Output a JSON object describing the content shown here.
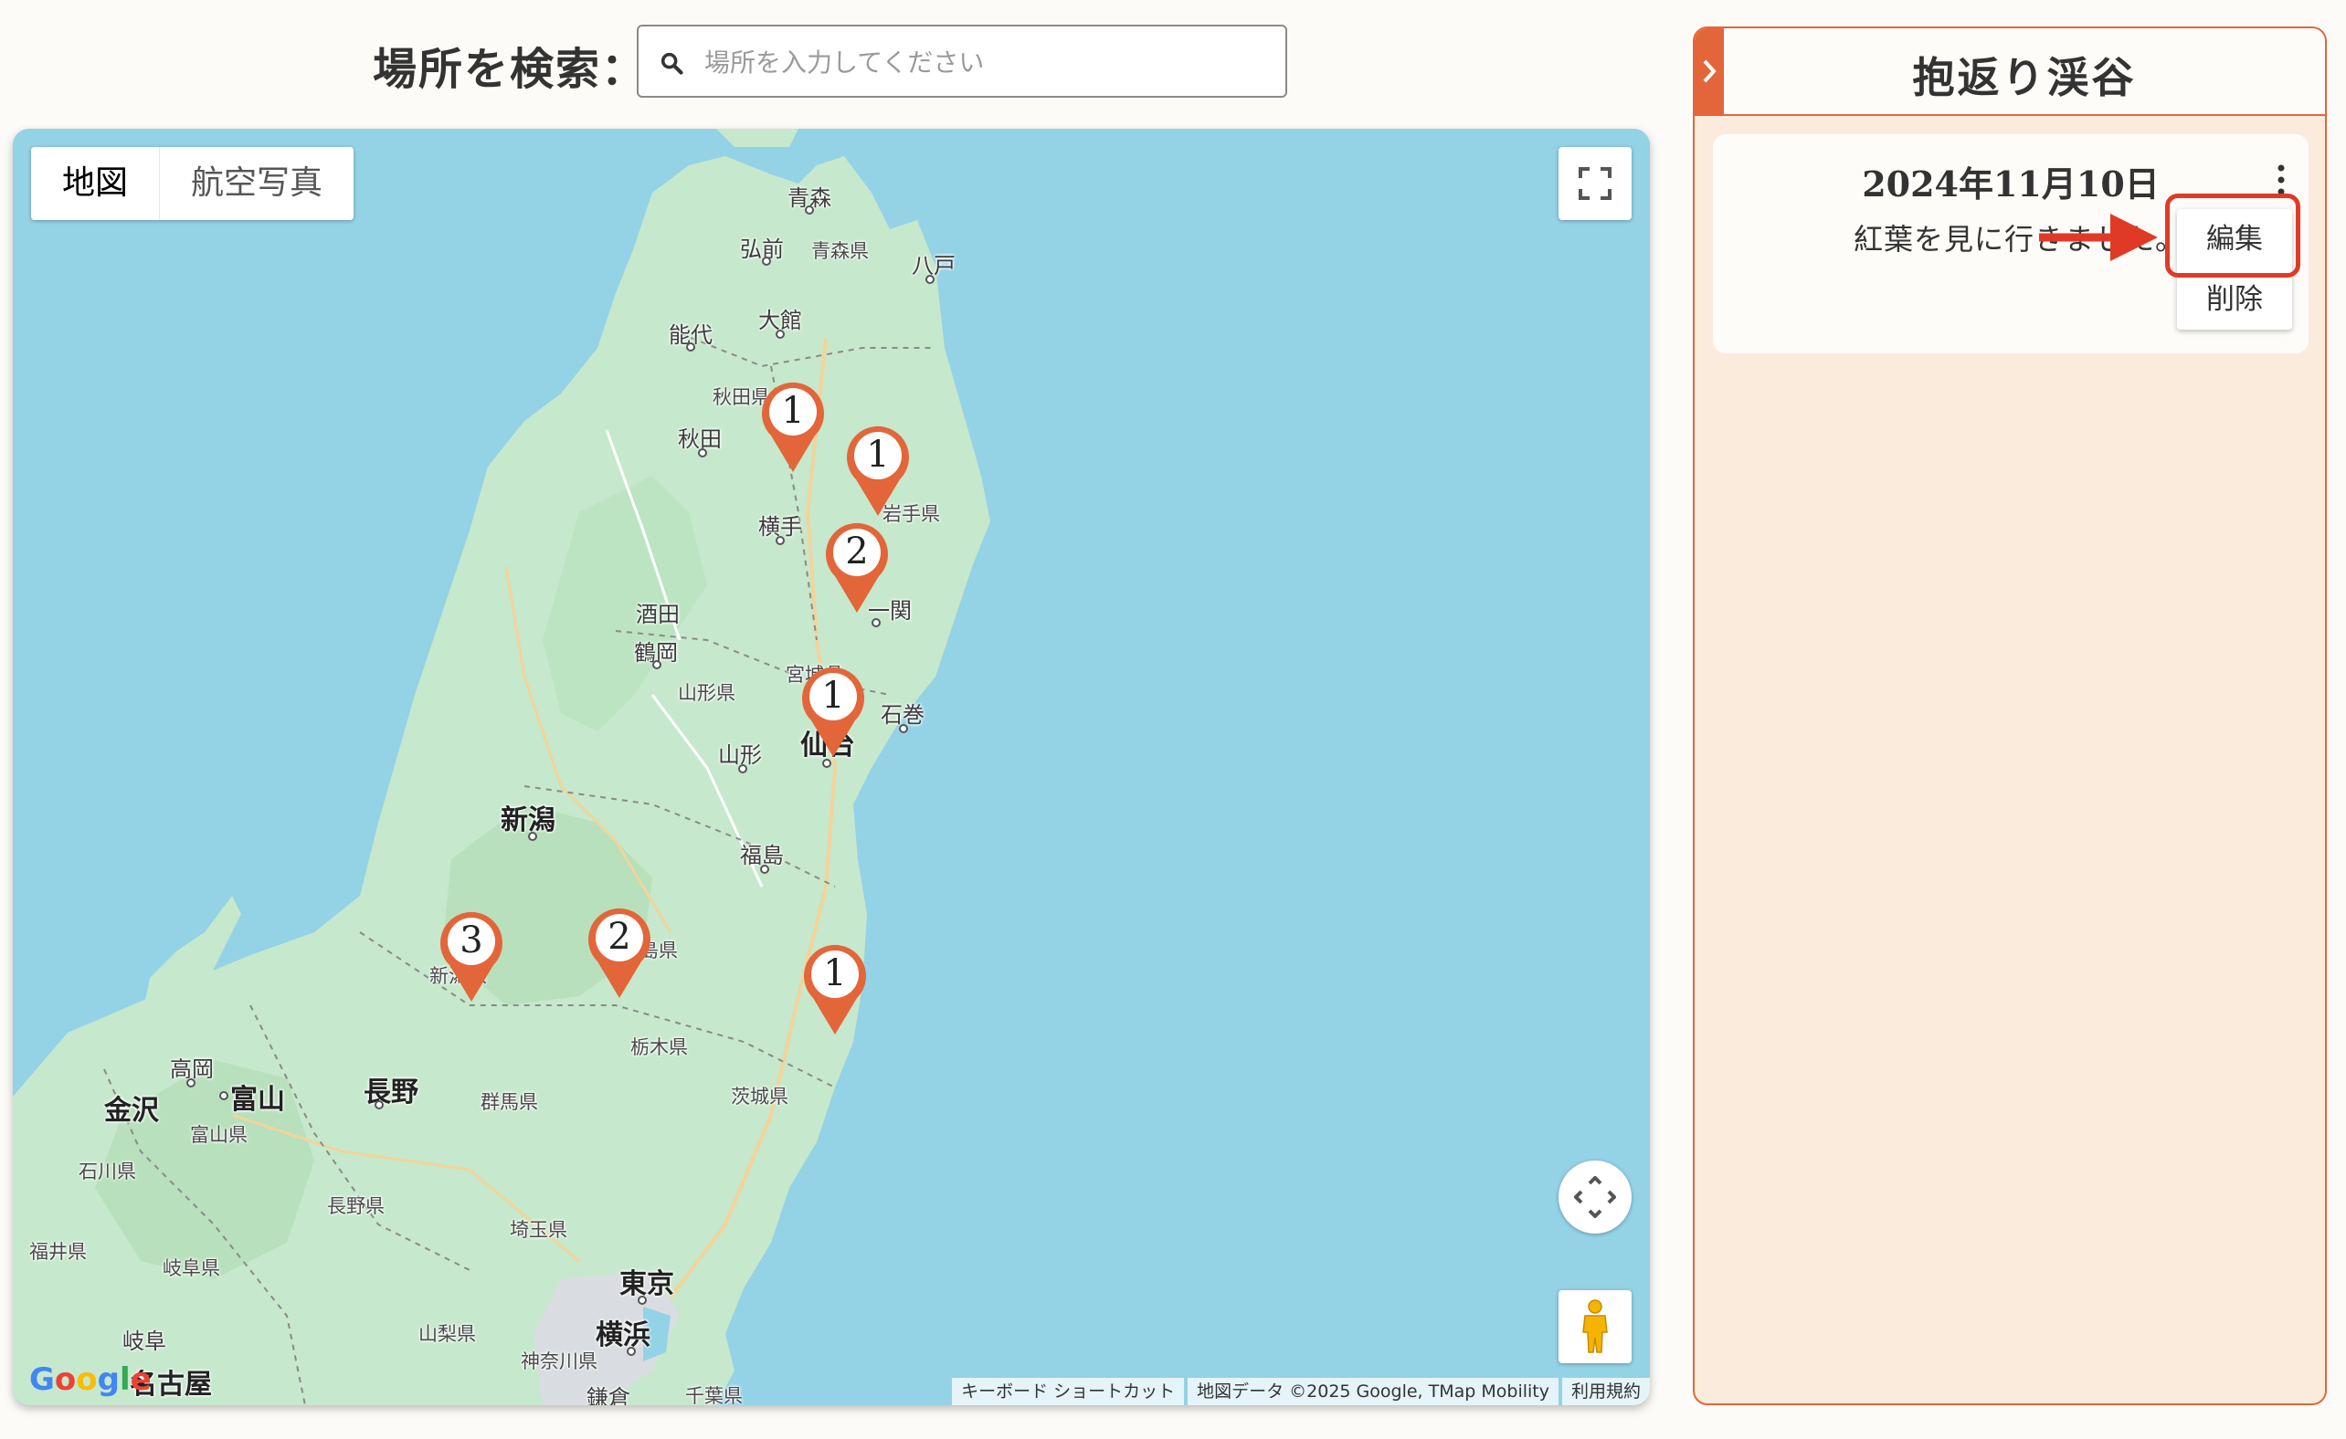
{
  "search": {
    "label": "場所を検索：",
    "placeholder": "場所を入力してください",
    "icon": "search-icon"
  },
  "map": {
    "type_controls": {
      "map": "地図",
      "satellite": "航空写真",
      "selected": "地図"
    },
    "controls": {
      "fullscreen": "fullscreen-icon",
      "camera": "camera-control-icon",
      "pegman": "pegman-icon"
    },
    "logo": "Google",
    "attribution": {
      "shortcuts": "キーボード ショートカット",
      "data": "地図データ ©2025 Google, TMap Mobility",
      "terms": "利用規約"
    },
    "labels": {
      "aomori": "青森",
      "hirosaki": "弘前",
      "aomori_pref": "青森県",
      "hachinohe": "八戸",
      "noshiro": "能代",
      "odate": "大館",
      "akita_pref": "秋田県",
      "akita": "秋田",
      "iwate_pref": "岩手県",
      "yokote": "横手",
      "ichinoseki": "一関",
      "sakata": "酒田",
      "tsuruoka": "鶴岡",
      "miyagi_pref": "宮城県",
      "yamagata_pref": "山形県",
      "ishinomaki": "石巻",
      "sendai": "仙台",
      "yamagata": "山形",
      "niigata": "新潟",
      "fukushima": "福島",
      "fukushima_pref": "島県",
      "niigata_pref": "新潟県",
      "tochigi_pref": "栃木県",
      "ibaraki_pref": "茨城県",
      "takaoka": "高岡",
      "toyama": "富山",
      "kanazawa": "金沢",
      "nagano": "長野",
      "gunma_pref": "群馬県",
      "toyama_pref": "富山県",
      "ishikawa_pref": "石川県",
      "nagano_pref": "長野県",
      "saitama_pref": "埼玉県",
      "fukui_pref": "福井県",
      "gifu_pref": "岐阜県",
      "tokyo": "東京",
      "gifu": "岐阜",
      "yamanashi_pref": "山梨県",
      "yokohama": "横浜",
      "nagoya": "名古屋",
      "kanagawa_pref": "神奈川県",
      "kamakura": "鎌倉",
      "chiba_pref": "千葉県"
    },
    "markers": [
      {
        "count": "1"
      },
      {
        "count": "1"
      },
      {
        "count": "2"
      },
      {
        "count": "1"
      },
      {
        "count": "3"
      },
      {
        "count": "2"
      },
      {
        "count": "1"
      }
    ],
    "colors": {
      "water": "#94d2e6",
      "land": "#c6e8cc",
      "marker": "#e2663a"
    }
  },
  "panel": {
    "title": "抱返り渓谷",
    "entry": {
      "date": "2024年11月10日",
      "text": "紅葉を見に行きました。",
      "menu": {
        "edit": "編集",
        "delete": "削除"
      }
    },
    "colors": {
      "accent": "#e2663a",
      "highlight": "#e03a27",
      "background": "#faebdc"
    }
  }
}
